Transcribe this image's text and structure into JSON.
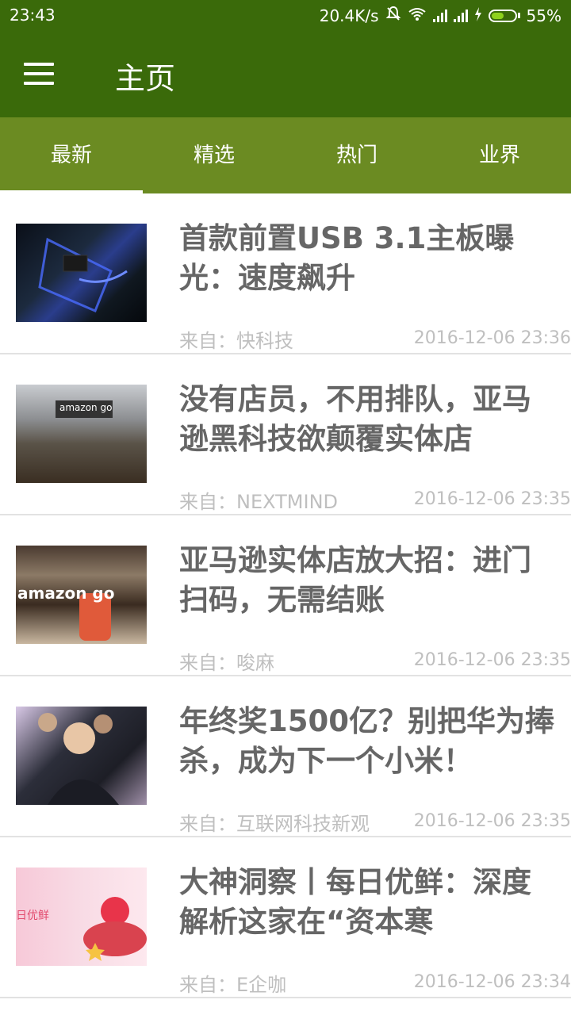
{
  "status_bar": {
    "time": "23:43",
    "network_speed": "20.4K/s",
    "battery": "55%"
  },
  "app_bar": {
    "title": "主页"
  },
  "tabs": [
    {
      "label": "最新",
      "active": true
    },
    {
      "label": "精选",
      "active": false
    },
    {
      "label": "热门",
      "active": false
    },
    {
      "label": "业界",
      "active": false
    }
  ],
  "articles": [
    {
      "title": "首款前置USB 3.1主板曝光：速度飙升",
      "source": "来自：快科技",
      "date": "2016-12-06 23:36"
    },
    {
      "title": "没有店员，不用排队，亚马逊黑科技欲颠覆实体店",
      "source": "来自：NEXTMIND",
      "date": "2016-12-06 23:35"
    },
    {
      "title": "亚马逊实体店放大招：进门扫码，无需结账",
      "source": "来自：唆麻",
      "date": "2016-12-06 23:35"
    },
    {
      "title": "年终奖1500亿？别把华为捧杀，成为下一个小米！",
      "source": "来自：互联网科技新观",
      "date": "2016-12-06 23:35"
    },
    {
      "title": "大神洞察丨每日优鲜：深度解析这家在“资本寒",
      "source": "来自：E企咖",
      "date": "2016-12-06 23:34"
    }
  ],
  "thumb_labels": {
    "amazon_go_1": "amazon go",
    "amazon_go_2": "amazon go",
    "meiriyouxian": "日优鲜"
  },
  "colors": {
    "appbar": "#3a6a0a",
    "tabbar": "#6b8b22",
    "title_text": "#666666",
    "meta_text": "#bfbfbf"
  }
}
